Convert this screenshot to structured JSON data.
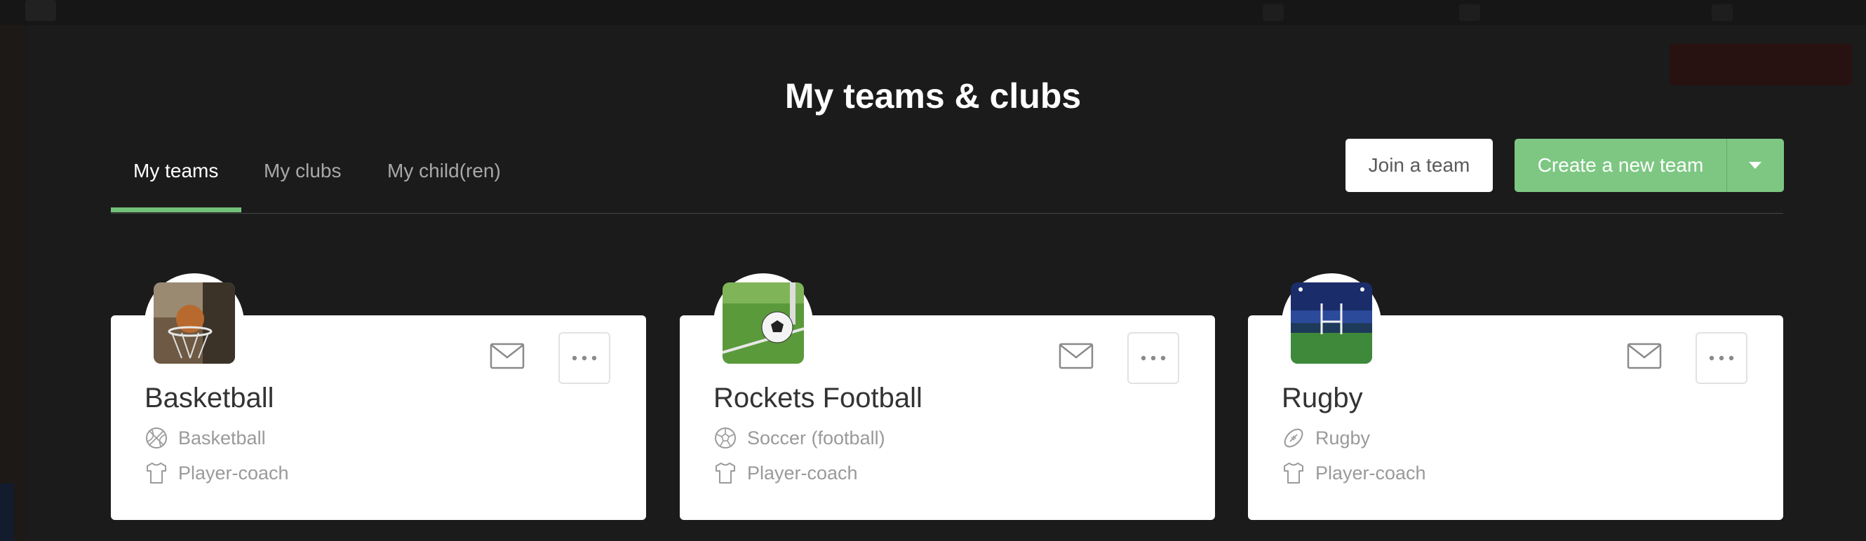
{
  "modal": {
    "title": "My teams & clubs"
  },
  "tabs": [
    {
      "label": "My teams",
      "active": true
    },
    {
      "label": "My clubs",
      "active": false
    },
    {
      "label": "My child(ren)",
      "active": false
    }
  ],
  "actions": {
    "join_label": "Join a team",
    "create_label": "Create a new team"
  },
  "teams": [
    {
      "name": "Basketball",
      "sport": "Basketball",
      "role": "Player-coach",
      "sport_icon": "basketball-icon"
    },
    {
      "name": "Rockets Football",
      "sport": "Soccer (football)",
      "role": "Player-coach",
      "sport_icon": "soccer-ball-icon"
    },
    {
      "name": "Rugby",
      "sport": "Rugby",
      "role": "Player-coach",
      "sport_icon": "rugby-ball-icon"
    }
  ],
  "colors": {
    "accent": "#7dc783",
    "modal_bg": "#1f1f1f",
    "card_bg": "#ffffff"
  }
}
